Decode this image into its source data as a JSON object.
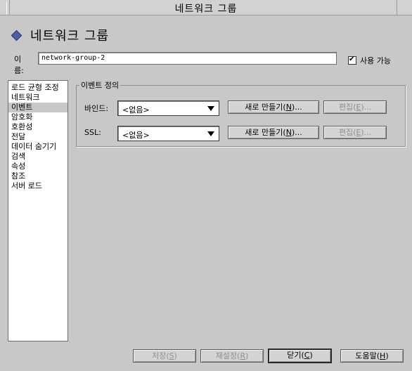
{
  "window": {
    "title": "네트워크 그룹"
  },
  "header": {
    "title": "네트워크 그룹"
  },
  "name": {
    "label": "이름:",
    "value": "network-group-2"
  },
  "enable": {
    "label": "사용 가능",
    "checked": true
  },
  "sidebar": {
    "items": [
      {
        "label": "로드 균형 조정"
      },
      {
        "label": "네트워크"
      },
      {
        "label": "이벤트",
        "selected": true
      },
      {
        "label": "암호화"
      },
      {
        "label": "호환성"
      },
      {
        "label": "전달"
      },
      {
        "label": "데이터 숨기기"
      },
      {
        "label": "검색"
      },
      {
        "label": "속성"
      },
      {
        "label": "참조"
      },
      {
        "label": "서버 로드"
      }
    ]
  },
  "event_definition": {
    "title": "이벤트 정의",
    "bind": {
      "label": "바인드:",
      "value": "<없음>",
      "new_label": "새로 만들기(",
      "new_mnemonic": "N",
      "new_suffix": ")...",
      "edit_label": "편집(",
      "edit_mnemonic": "E",
      "edit_suffix": ")..."
    },
    "ssl": {
      "label": "SSL:",
      "value": "<없음>",
      "new_label": "새로 만들기(",
      "new_mnemonic": "N",
      "new_suffix": ")...",
      "edit_label": "편집(",
      "edit_mnemonic": "E",
      "edit_suffix": ")..."
    }
  },
  "footer": {
    "save": {
      "label": "저장(",
      "mnemonic": "S",
      "suffix": ")"
    },
    "reset": {
      "label": "재설정(",
      "mnemonic": "R",
      "suffix": ")"
    },
    "close": {
      "label": "닫기(",
      "mnemonic": "C",
      "suffix": ")"
    },
    "help": {
      "label": "도움말(",
      "mnemonic": "H",
      "suffix": ")"
    }
  },
  "colors": {
    "background": "#c8c8c8",
    "accent_icon": "#4e5fa8"
  },
  "icons": {
    "header": "diamond-icon",
    "combo": "chevron-down-icon"
  }
}
